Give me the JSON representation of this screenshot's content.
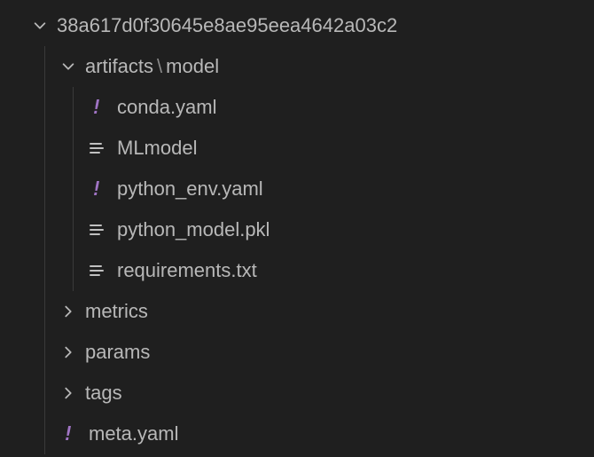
{
  "root": {
    "name": "38a617d0f30645e8ae95eea4642a03c2",
    "children": {
      "artifacts_model": {
        "segment0": "artifacts",
        "segment1": "model",
        "files": [
          {
            "label": "conda.yaml",
            "icon": "yaml"
          },
          {
            "label": "MLmodel",
            "icon": "text"
          },
          {
            "label": "python_env.yaml",
            "icon": "yaml"
          },
          {
            "label": "python_model.pkl",
            "icon": "text"
          },
          {
            "label": "requirements.txt",
            "icon": "text"
          }
        ]
      },
      "folders": [
        {
          "label": "metrics"
        },
        {
          "label": "params"
        },
        {
          "label": "tags"
        }
      ],
      "root_files": [
        {
          "label": "meta.yaml",
          "icon": "yaml"
        }
      ]
    }
  }
}
